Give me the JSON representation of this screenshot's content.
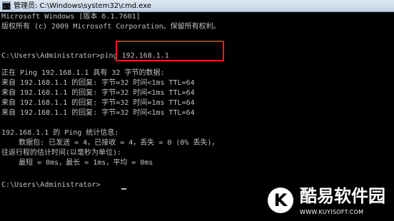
{
  "window": {
    "title": "管理员: C:\\Windows\\system32\\cmd.exe",
    "icon": "cmd-icon"
  },
  "console": {
    "lines": [
      "Microsoft Windows [版本 6.1.7601]",
      "版权所有 (c) 2009 Microsoft Corporation。保留所有权利。",
      "",
      "C:\\Users\\Administrator>ping 192.168.1.1",
      "",
      "正在 Ping 192.168.1.1 具有 32 字节的数据:",
      "来自 192.168.1.1 的回复: 字节=32 时间<1ms TTL=64",
      "来自 192.168.1.1 的回复: 字节=32 时间<1ms TTL=64",
      "来自 192.168.1.1 的回复: 字节=32 时间=1ms TTL=64",
      "来自 192.168.1.1 的回复: 字节=32 时间<1ms TTL=64",
      "",
      "192.168.1.1 的 Ping 统计信息:",
      "    数据包: 已发送 = 4，已接收 = 4，丢失 = 0 (0% 丢失)，",
      "往返行程的估计时间(以毫秒为单位):",
      "    最短 = 0ms，最长 = 1ms，平均 = 0ms",
      "",
      "",
      "C:\\Users\\Administrator>"
    ],
    "highlighted_command": "ping 192.168.1.1"
  },
  "watermark": {
    "name": "酷易软件园",
    "url": "WWW.KUYISOFT.COM",
    "logo_letter": "K"
  },
  "colors": {
    "console_bg": "#000000",
    "console_fg": "#c0c0c0",
    "highlight": "#e02020"
  }
}
